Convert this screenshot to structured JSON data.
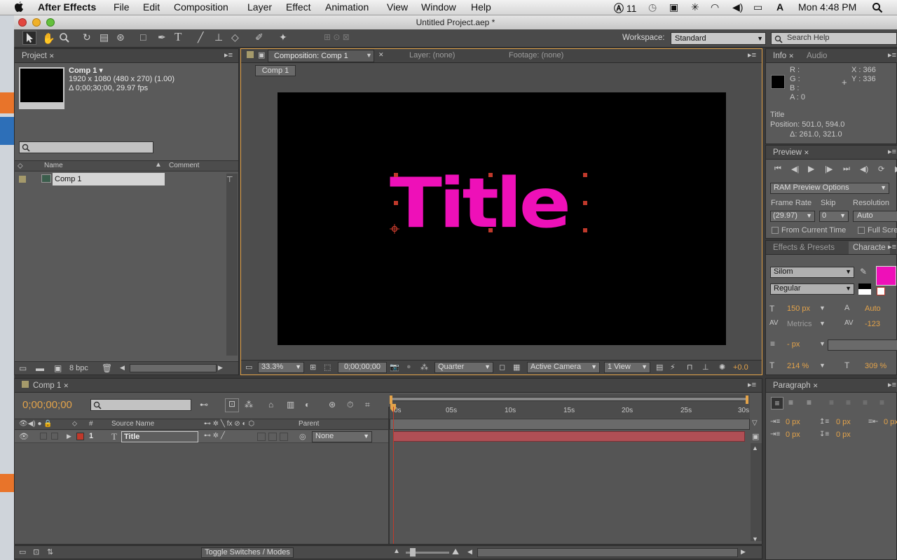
{
  "menubar": {
    "app": "After Effects",
    "items": [
      "File",
      "Edit",
      "Composition",
      "Layer",
      "Effect",
      "Animation",
      "View",
      "Window",
      "Help"
    ],
    "status": {
      "adobe": "11",
      "clock": "Mon 4:48 PM"
    }
  },
  "window": {
    "title": "Untitled Project.aep *"
  },
  "toolbar": {
    "workspace_label": "Workspace:",
    "workspace_value": "Standard",
    "search_placeholder": "Search Help"
  },
  "project": {
    "tab": "Project",
    "item_name": "Comp 1 ▾",
    "item_dims": "1920 x 1080  (480 x 270) (1.00)",
    "item_dur": "Δ 0;00;30;00, 29.97 fps",
    "col_name": "Name",
    "col_comment": "Comment",
    "row_name": "Comp 1",
    "bpc": "8 bpc"
  },
  "composition": {
    "tab": "Composition: Comp 1",
    "layer_tab": "Layer: (none)",
    "footage_tab": "Footage: (none)",
    "comp_button": "Comp 1",
    "title_text": "Title",
    "zoom": "33.3%",
    "timecode": "0;00;00;00",
    "resolution": "Quarter",
    "camera": "Active Camera",
    "views": "1 View",
    "exposure": "+0.0"
  },
  "info": {
    "tab": "Info",
    "audio_tab": "Audio",
    "r": "R :",
    "g": "G :",
    "b": "B :",
    "a": "A : 0",
    "x": "X : 366",
    "y": "Y : 336",
    "layer": "Title",
    "position": "Position: 501.0, 594.0",
    "delta": "Δ: 261.0, 321.0"
  },
  "preview": {
    "tab": "Preview",
    "ram_options": "RAM Preview Options",
    "frame_rate_label": "Frame Rate",
    "skip_label": "Skip",
    "resolution_label": "Resolution",
    "frame_rate": "(29.97)",
    "skip": "0",
    "resolution": "Auto",
    "from_current": "From Current Time",
    "full_screen": "Full Scre"
  },
  "character": {
    "effects_tab": "Effects & Presets",
    "char_tab": "Characte",
    "font": "Silom",
    "style": "Regular",
    "size": "150 px",
    "leading": "Auto",
    "kerning": "Metrics",
    "tracking": "-123",
    "stroke": "- px",
    "vscale": "214 %",
    "hscale": "309 %",
    "fill_color": "#ee10b8"
  },
  "timeline": {
    "tab": "Comp 1",
    "timecode": "0;00;00;00",
    "ruler": [
      "0s",
      "05s",
      "10s",
      "15s",
      "20s",
      "25s",
      "30s"
    ],
    "col_num": "#",
    "col_source": "Source Name",
    "col_parent": "Parent",
    "layer_num": "1",
    "layer_name": "Title",
    "layer_parent": "None",
    "toggle": "Toggle Switches / Modes"
  },
  "paragraph": {
    "tab": "Paragraph",
    "v1": "0 px",
    "v2": "0 px",
    "v3": "0 px",
    "v4": "0 px",
    "v5": "0 px"
  }
}
